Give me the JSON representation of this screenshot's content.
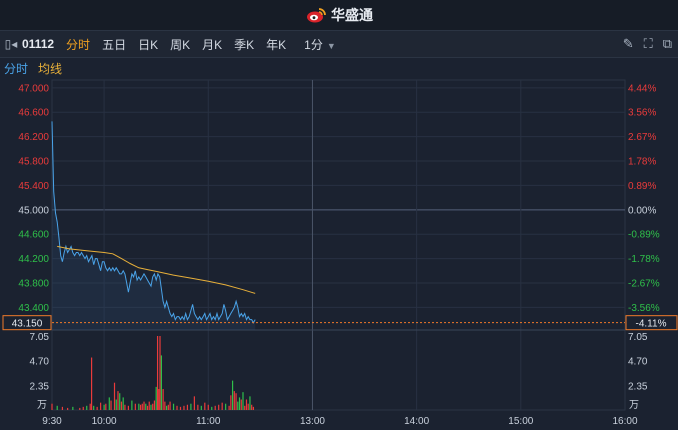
{
  "app": {
    "brand": "华盛通",
    "brand_color": "#d8232a"
  },
  "toolbar": {
    "code": "01112",
    "tabs": [
      {
        "label": "分时",
        "active": true
      },
      {
        "label": "五日",
        "active": false
      },
      {
        "label": "日K",
        "active": false
      },
      {
        "label": "周K",
        "active": false
      },
      {
        "label": "月K",
        "active": false
      },
      {
        "label": "季K",
        "active": false
      },
      {
        "label": "年K",
        "active": false
      }
    ],
    "period": "1分",
    "icons": [
      "sidebar-toggle-icon",
      "pen-icon",
      "fullscreen-icon",
      "popout-icon"
    ]
  },
  "legend": {
    "price_label": "分时",
    "avg_label": "均线"
  },
  "colors": {
    "up": "#ea3b3b",
    "down": "#2fc04a",
    "price_line": "#4aa3e8",
    "avg_line": "#e8b03a",
    "current": "#f07a2a"
  },
  "chart_data": {
    "type": "line",
    "prev_close": 45.0,
    "current_price": "43.150",
    "current_change": "-4.11%",
    "ylim": [
      43.03,
      47.03
    ],
    "left_ticks": [
      "47.000",
      "46.600",
      "46.200",
      "45.800",
      "45.400",
      "45.000",
      "44.600",
      "44.200",
      "43.800",
      "43.400"
    ],
    "left_tick_values": [
      47.0,
      46.6,
      46.2,
      45.8,
      45.4,
      45.0,
      44.6,
      44.2,
      43.8,
      43.4
    ],
    "right_ticks": [
      "4.44%",
      "3.56%",
      "2.67%",
      "1.78%",
      "0.89%",
      "0.00%",
      "-0.89%",
      "-1.78%",
      "-2.67%",
      "-3.56%"
    ],
    "x_ticks": [
      "9:30",
      "10:00",
      "11:00",
      "13:00",
      "14:00",
      "15:00",
      "16:00"
    ],
    "x_tick_minutes": [
      0,
      30,
      90,
      150,
      210,
      270,
      330
    ],
    "price_series": [
      [
        0,
        46.45
      ],
      [
        1,
        45.3
      ],
      [
        2,
        44.95
      ],
      [
        3,
        44.8
      ],
      [
        4,
        44.55
      ],
      [
        5,
        44.25
      ],
      [
        6,
        44.15
      ],
      [
        7,
        44.3
      ],
      [
        8,
        44.4
      ],
      [
        9,
        44.3
      ],
      [
        10,
        44.35
      ],
      [
        11,
        44.4
      ],
      [
        12,
        44.3
      ],
      [
        13,
        44.25
      ],
      [
        14,
        44.3
      ],
      [
        15,
        44.3
      ],
      [
        16,
        44.25
      ],
      [
        17,
        44.3
      ],
      [
        18,
        44.25
      ],
      [
        19,
        44.2
      ],
      [
        20,
        44.25
      ],
      [
        21,
        44.15
      ],
      [
        22,
        44.2
      ],
      [
        23,
        44.25
      ],
      [
        24,
        44.1
      ],
      [
        25,
        44.2
      ],
      [
        26,
        44.2
      ],
      [
        27,
        44.1
      ],
      [
        28,
        44.0
      ],
      [
        29,
        44.15
      ],
      [
        30,
        44.15
      ],
      [
        31,
        44.05
      ],
      [
        32,
        44.0
      ],
      [
        33,
        44.05
      ],
      [
        34,
        44.0
      ],
      [
        35,
        44.05
      ],
      [
        36,
        44.0
      ],
      [
        37,
        44.05
      ],
      [
        38,
        44.0
      ],
      [
        39,
        43.95
      ],
      [
        40,
        43.95
      ],
      [
        41,
        44.0
      ],
      [
        42,
        43.95
      ],
      [
        43,
        43.8
      ],
      [
        44,
        43.65
      ],
      [
        45,
        43.8
      ],
      [
        46,
        43.95
      ],
      [
        47,
        43.9
      ],
      [
        48,
        44.0
      ],
      [
        49,
        43.85
      ],
      [
        50,
        43.9
      ],
      [
        51,
        43.85
      ],
      [
        52,
        43.9
      ],
      [
        53,
        43.95
      ],
      [
        54,
        43.9
      ],
      [
        55,
        43.85
      ],
      [
        56,
        43.8
      ],
      [
        57,
        43.75
      ],
      [
        58,
        43.9
      ],
      [
        59,
        43.95
      ],
      [
        60,
        43.85
      ],
      [
        61,
        43.95
      ],
      [
        62,
        43.9
      ],
      [
        63,
        43.7
      ],
      [
        64,
        43.5
      ],
      [
        65,
        43.4
      ],
      [
        66,
        43.5
      ],
      [
        67,
        43.4
      ],
      [
        68,
        43.3
      ],
      [
        69,
        43.25
      ],
      [
        70,
        43.3
      ],
      [
        71,
        43.2
      ],
      [
        72,
        43.25
      ],
      [
        73,
        43.25
      ],
      [
        74,
        43.2
      ],
      [
        75,
        43.25
      ],
      [
        76,
        43.2
      ],
      [
        77,
        43.3
      ],
      [
        78,
        43.2
      ],
      [
        79,
        43.25
      ],
      [
        80,
        43.35
      ],
      [
        81,
        43.45
      ],
      [
        82,
        43.3
      ],
      [
        83,
        43.25
      ],
      [
        84,
        43.2
      ],
      [
        85,
        43.25
      ],
      [
        86,
        43.2
      ],
      [
        87,
        43.25
      ],
      [
        88,
        43.3
      ],
      [
        89,
        43.2
      ],
      [
        90,
        43.25
      ],
      [
        91,
        43.3
      ],
      [
        92,
        43.2
      ],
      [
        93,
        43.25
      ],
      [
        94,
        43.2
      ],
      [
        95,
        43.3
      ],
      [
        96,
        43.2
      ],
      [
        97,
        43.25
      ],
      [
        98,
        43.3
      ],
      [
        99,
        43.45
      ],
      [
        100,
        43.35
      ],
      [
        101,
        43.2
      ],
      [
        102,
        43.25
      ],
      [
        103,
        43.3
      ],
      [
        104,
        43.35
      ],
      [
        105,
        43.4
      ],
      [
        106,
        43.5
      ],
      [
        107,
        43.4
      ],
      [
        108,
        43.25
      ],
      [
        109,
        43.3
      ],
      [
        110,
        43.25
      ],
      [
        111,
        43.3
      ],
      [
        112,
        43.2
      ],
      [
        113,
        43.25
      ],
      [
        114,
        43.2
      ],
      [
        115,
        43.2
      ],
      [
        116,
        43.15
      ],
      [
        117,
        43.2
      ]
    ],
    "avg_series": [
      [
        3,
        44.4
      ],
      [
        10,
        44.36
      ],
      [
        20,
        44.33
      ],
      [
        30,
        44.3
      ],
      [
        35,
        44.28
      ],
      [
        40,
        44.2
      ],
      [
        45,
        44.12
      ],
      [
        50,
        44.05
      ],
      [
        55,
        44.02
      ],
      [
        60,
        43.99
      ],
      [
        70,
        43.93
      ],
      [
        80,
        43.88
      ],
      [
        90,
        43.83
      ],
      [
        100,
        43.77
      ],
      [
        110,
        43.69
      ],
      [
        117,
        43.63
      ]
    ],
    "volume_ylim": [
      0,
      7.05
    ],
    "volume_ticks_left": [
      "7.05",
      "4.70",
      "2.35",
      "万"
    ],
    "volume_ticks_right": [
      "7.05",
      "4.70",
      "2.35",
      "万"
    ],
    "volume_tick_values": [
      7.05,
      4.7,
      2.35
    ],
    "volume_series": [
      [
        0,
        0.6,
        "up"
      ],
      [
        3,
        0.4,
        "down"
      ],
      [
        6,
        0.3,
        "up"
      ],
      [
        9,
        0.2,
        "up"
      ],
      [
        12,
        0.3,
        "down"
      ],
      [
        16,
        0.2,
        "up"
      ],
      [
        18,
        0.3,
        "up"
      ],
      [
        20,
        0.4,
        "down"
      ],
      [
        22,
        0.6,
        "up"
      ],
      [
        22.8,
        5.0,
        "up"
      ],
      [
        24,
        0.4,
        "down"
      ],
      [
        26,
        0.3,
        "up"
      ],
      [
        28,
        0.7,
        "up"
      ],
      [
        30,
        0.5,
        "down"
      ],
      [
        31,
        0.6,
        "up"
      ],
      [
        33,
        1.2,
        "down"
      ],
      [
        34,
        0.9,
        "up"
      ],
      [
        36,
        2.6,
        "up"
      ],
      [
        37,
        1.0,
        "down"
      ],
      [
        38,
        1.8,
        "up"
      ],
      [
        39,
        1.6,
        "down"
      ],
      [
        40,
        0.8,
        "up"
      ],
      [
        41,
        1.2,
        "down"
      ],
      [
        42,
        0.5,
        "up"
      ],
      [
        44,
        0.4,
        "up"
      ],
      [
        46,
        0.9,
        "down"
      ],
      [
        48,
        0.6,
        "up"
      ],
      [
        50,
        0.6,
        "down"
      ],
      [
        51,
        0.5,
        "up"
      ],
      [
        52,
        0.6,
        "up"
      ],
      [
        53,
        0.8,
        "up"
      ],
      [
        54,
        0.6,
        "down"
      ],
      [
        55,
        0.4,
        "up"
      ],
      [
        56,
        0.8,
        "up"
      ],
      [
        57,
        0.5,
        "down"
      ],
      [
        58,
        0.6,
        "up"
      ],
      [
        59,
        0.9,
        "up"
      ],
      [
        60,
        2.2,
        "down"
      ],
      [
        60.8,
        7.05,
        "up"
      ],
      [
        61.5,
        2.0,
        "up"
      ],
      [
        62.2,
        7.05,
        "up"
      ],
      [
        63,
        5.2,
        "down"
      ],
      [
        64,
        2.0,
        "up"
      ],
      [
        65,
        0.8,
        "up"
      ],
      [
        66,
        0.4,
        "down"
      ],
      [
        67,
        0.5,
        "up"
      ],
      [
        68,
        0.8,
        "up"
      ],
      [
        70,
        0.6,
        "down"
      ],
      [
        72,
        0.4,
        "up"
      ],
      [
        74,
        0.3,
        "up"
      ],
      [
        76,
        0.4,
        "up"
      ],
      [
        78,
        0.5,
        "up"
      ],
      [
        80,
        0.6,
        "down"
      ],
      [
        82,
        1.3,
        "up"
      ],
      [
        84,
        0.5,
        "up"
      ],
      [
        86,
        0.4,
        "down"
      ],
      [
        88,
        0.7,
        "up"
      ],
      [
        90,
        0.5,
        "up"
      ],
      [
        92,
        0.3,
        "down"
      ],
      [
        94,
        0.4,
        "up"
      ],
      [
        96,
        0.5,
        "up"
      ],
      [
        98,
        0.7,
        "up"
      ],
      [
        100,
        0.6,
        "down"
      ],
      [
        102,
        0.4,
        "up"
      ],
      [
        103,
        1.4,
        "up"
      ],
      [
        104,
        2.8,
        "down"
      ],
      [
        105,
        1.8,
        "up"
      ],
      [
        106,
        1.6,
        "up"
      ],
      [
        107,
        0.8,
        "down"
      ],
      [
        108,
        1.2,
        "down"
      ],
      [
        109,
        1.0,
        "up"
      ],
      [
        110,
        1.7,
        "down"
      ],
      [
        111,
        0.4,
        "up"
      ],
      [
        112,
        1.0,
        "up"
      ],
      [
        113,
        0.6,
        "up"
      ],
      [
        114,
        1.3,
        "down"
      ],
      [
        115,
        0.5,
        "up"
      ],
      [
        116,
        0.3,
        "up"
      ]
    ]
  }
}
